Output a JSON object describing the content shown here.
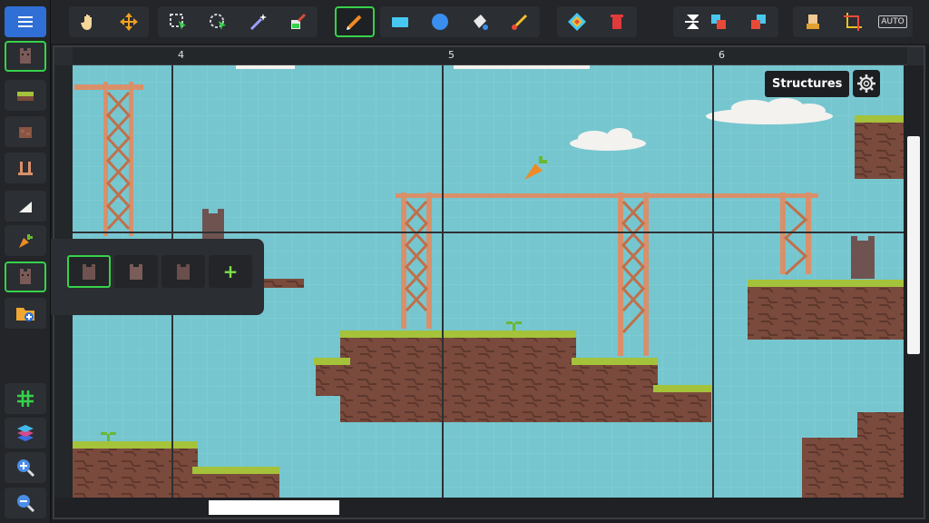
{
  "left_toolbar": {
    "items": [
      {
        "name": "menu-icon"
      },
      {
        "name": "creature-brush-icon",
        "selected": true
      },
      {
        "name": "grass-tile-icon"
      },
      {
        "name": "dirt-block-icon"
      },
      {
        "name": "pillar-icon"
      },
      {
        "name": "slope-icon"
      },
      {
        "name": "carrot-icon"
      },
      {
        "name": "creature-brush-icon",
        "selected": true
      },
      {
        "name": "add-folder-icon"
      },
      {
        "name": "grid-icon"
      },
      {
        "name": "layers-icon"
      },
      {
        "name": "zoom-in-icon"
      },
      {
        "name": "zoom-out-icon"
      }
    ]
  },
  "top_toolbar": {
    "tools": [
      "hand-icon",
      "move-icon",
      "select-icon",
      "lasso-select-icon",
      "magic-wand-icon",
      "paint-bucket-icon",
      "pencil-icon",
      "rectangle-icon",
      "ellipse-icon",
      "fill-icon",
      "brush-icon",
      "pattern-icon",
      "delete-icon",
      "flip-icon",
      "swap-icon",
      "swap-alt-icon",
      "stamp-icon",
      "crop-icon",
      "auto-icon"
    ],
    "selected_tool": "pencil-icon",
    "auto_label": "AUTO"
  },
  "rulers": {
    "top": [
      "4",
      "5",
      "6"
    ]
  },
  "structures": {
    "label": "Structures"
  },
  "brush_popup": {
    "slots": [
      "creature-icon",
      "creature-icon",
      "creature-icon"
    ],
    "add_label": "+"
  },
  "colors": {
    "accent": "#36d24a",
    "sky": "#76c6cf",
    "grass": "#a4c23a",
    "dirt": "#7a4a3c",
    "wood": "#d9906a"
  }
}
